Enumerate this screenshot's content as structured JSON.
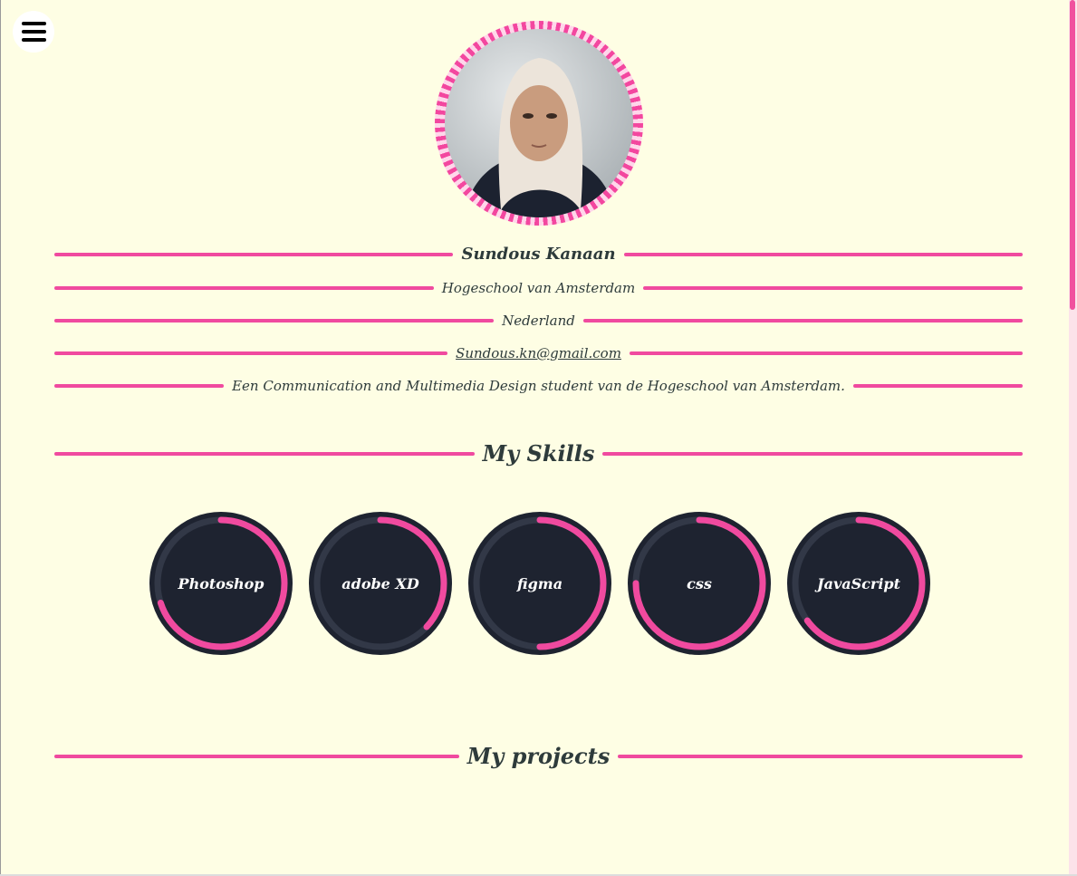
{
  "header": {
    "menu_icon": "hamburger-menu-icon"
  },
  "profile": {
    "name": "Sundous Kanaan",
    "school": "Hogeschool van Amsterdam",
    "country": "Nederland",
    "email": "Sundous.kn@gmail.com",
    "description": "Een Communication and Multimedia Design student van de Hogeschool van Amsterdam."
  },
  "skills_section": {
    "title": "My Skills",
    "skills": [
      {
        "name": "Photoshop",
        "level": 0.7
      },
      {
        "name": "adobe XD",
        "level": 0.37
      },
      {
        "name": "figma",
        "level": 0.5
      },
      {
        "name": "css",
        "level": 0.75
      },
      {
        "name": "JavaScript",
        "level": 0.65
      }
    ]
  },
  "projects_section": {
    "title": "My projects"
  },
  "colors": {
    "background": "#fefee4",
    "accent": "#f04a9f",
    "skill_dark": "#1e2330",
    "text": "#2e3b3b"
  }
}
